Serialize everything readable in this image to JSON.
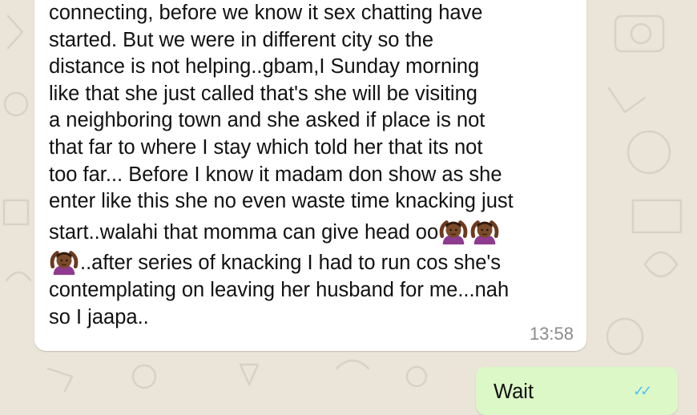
{
  "message_in": {
    "lines": [
      "connecting, before we know it sex chatting have",
      "started. But we were in different city so the",
      "distance is not helping..gbam,I Sunday morning",
      "like that she just called that's she will be visiting",
      "a neighboring town and she asked if place is not",
      "that far to where I stay which told her that its not",
      "too far... Before I know it madam don show as she",
      "enter like this she no even waste time knacking just"
    ],
    "line9_text": "start..walahi that momma can give head oo",
    "line10_text": "..after series of knacking I had to run cos she's",
    "line11": "contemplating on leaving her husband for me...nah",
    "line12": "so I jaapa..",
    "emoji_icon": "person-gesturing-ok-icon",
    "time": "13:58"
  },
  "message_out": {
    "text": "Wait",
    "status_icon": "double-check-icon"
  },
  "colors": {
    "background": "#ebe4d9",
    "incoming_bubble": "#ffffff",
    "outgoing_bubble": "#dcf8c6",
    "timestamp": "#8b8b8b",
    "read_check": "#4fc3f7"
  }
}
